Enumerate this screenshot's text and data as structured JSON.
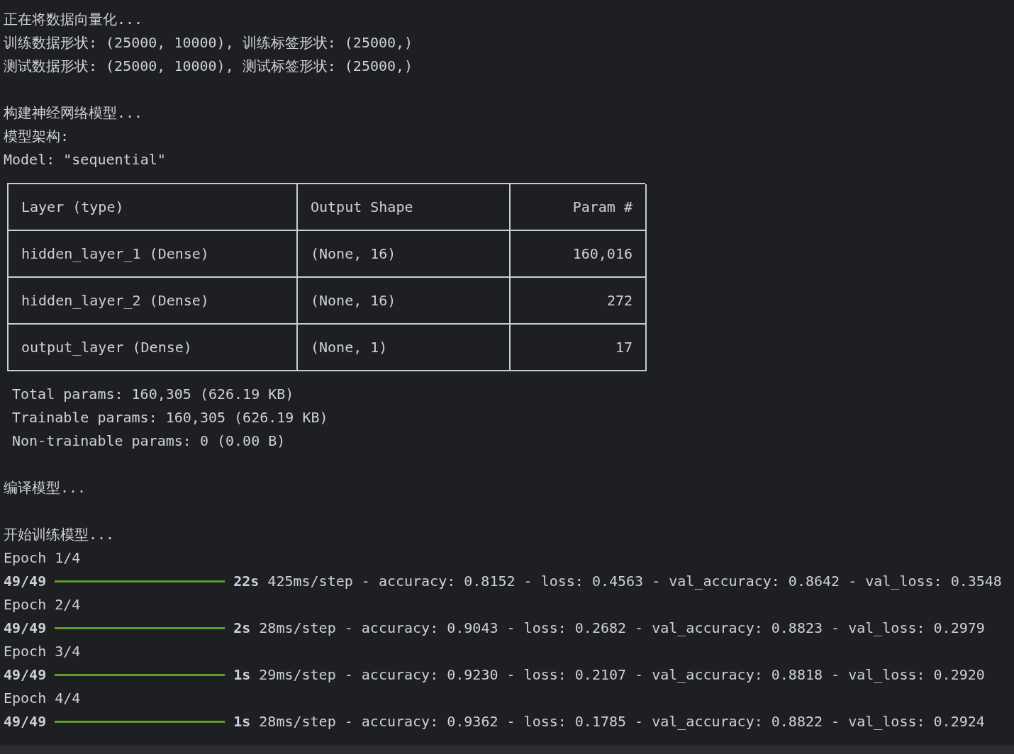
{
  "output": [
    {
      "kind": "text",
      "lines": [
        "正在将数据向量化...",
        "训练数据形状: (25000, 10000), 训练标签形状: (25000,)",
        "测试数据形状: (25000, 10000), 测试标签形状: (25000,)"
      ]
    },
    {
      "kind": "blank"
    },
    {
      "kind": "text",
      "lines": [
        "构建神经网络模型...",
        "模型架构:",
        "Model: \"sequential\""
      ]
    },
    {
      "kind": "table",
      "columns": [
        "Layer (type)",
        "Output Shape",
        "Param #"
      ],
      "rows": [
        [
          "hidden_layer_1 (Dense)",
          "(None, 16)",
          "160,016"
        ],
        [
          "hidden_layer_2 (Dense)",
          "(None, 16)",
          "272"
        ],
        [
          "output_layer (Dense)",
          "(None, 1)",
          "17"
        ]
      ]
    },
    {
      "kind": "indented",
      "lines": [
        "Total params: 160,305 (626.19 KB)",
        "Trainable params: 160,305 (626.19 KB)",
        "Non-trainable params: 0 (0.00 B)"
      ]
    },
    {
      "kind": "blank"
    },
    {
      "kind": "text",
      "lines": [
        "编译模型..."
      ]
    },
    {
      "kind": "blank"
    },
    {
      "kind": "text",
      "lines": [
        "开始训练模型..."
      ]
    },
    {
      "kind": "training",
      "epochs": [
        {
          "label": "Epoch 1/4",
          "steps": "49/49",
          "level": 1,
          "time": "22s",
          "metrics": "425ms/step - accuracy: 0.8152 - loss: 0.4563 - val_accuracy: 0.8642 - val_loss: 0.3548"
        },
        {
          "label": "Epoch 2/4",
          "steps": "49/49",
          "level": 1,
          "time": "2s",
          "metrics": "28ms/step - accuracy: 0.9043 - loss: 0.2682 - val_accuracy: 0.8823 - val_loss: 0.2979"
        },
        {
          "label": "Epoch 3/4",
          "steps": "49/49",
          "level": 1,
          "time": "1s",
          "metrics": "29ms/step - accuracy: 0.9230 - loss: 0.2107 - val_accuracy: 0.8818 - val_loss: 0.2920"
        },
        {
          "label": "Epoch 4/4",
          "steps": "49/49",
          "level": 1,
          "time": "1s",
          "metrics": "28ms/step - accuracy: 0.9362 - loss: 0.1785 - val_accuracy: 0.8822 - val_loss: 0.2924"
        }
      ]
    }
  ]
}
